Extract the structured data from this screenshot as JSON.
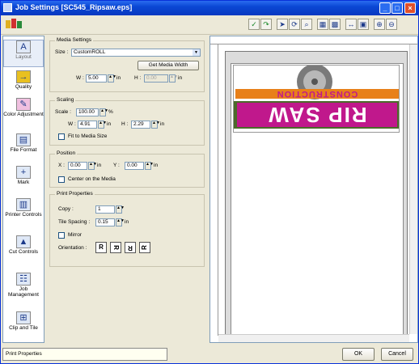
{
  "window": {
    "title": "Job Settings [SC545_Ripsaw.eps]"
  },
  "sidebar": {
    "items": [
      {
        "label": "Layout"
      },
      {
        "label": "Quality"
      },
      {
        "label": "Color Adjustment"
      },
      {
        "label": "File Format"
      },
      {
        "label": "Mark"
      },
      {
        "label": "Printer Controls"
      },
      {
        "label": "Cut Controls"
      },
      {
        "label": "Job Management"
      },
      {
        "label": "Clip and Tile"
      }
    ]
  },
  "media_settings": {
    "title": "Media Settings",
    "size_label": "Size :",
    "size_value": "CustomROLL",
    "get_media_width": "Get Media Width",
    "w_label": "W :",
    "w_value": "5.00",
    "w_unit": "in",
    "h_label": "H :",
    "h_value": "0.00",
    "h_unit": "in"
  },
  "scaling": {
    "title": "Scaling",
    "scale_label": "Scale :",
    "scale_value": "100.00",
    "scale_unit": "%",
    "w_label": "W :",
    "w_value": "4.91",
    "w_unit": "in",
    "h_label": "H :",
    "h_value": "2.29",
    "h_unit": "in",
    "fit_label": "Fit to Media Size"
  },
  "position": {
    "title": "Position",
    "x_label": "X :",
    "x_value": "0.00",
    "x_unit": "in",
    "y_label": "Y :",
    "y_value": "0.00",
    "y_unit": "in",
    "center_label": "Center on the Media"
  },
  "print_properties": {
    "title": "Print Properties",
    "copy_label": "Copy :",
    "copy_value": "1",
    "tile_label": "Tile Spacing :",
    "tile_value": "0.15",
    "tile_unit": "in",
    "mirror_label": "Mirror",
    "orientation_label": "Orientation :",
    "orientations": [
      "R",
      "R",
      "R",
      "R"
    ]
  },
  "artwork": {
    "text_top": "CONSTRUCTION",
    "text_main": "RIP SAW"
  },
  "status": {
    "text": "Print Properties"
  },
  "buttons": {
    "ok": "OK",
    "cancel": "Cancel"
  },
  "colors": {
    "titlebar": "#0a47d4",
    "artwork_magenta": "#c0188c",
    "artwork_orange": "#e8801a",
    "artwork_green": "#4c6a2a"
  }
}
